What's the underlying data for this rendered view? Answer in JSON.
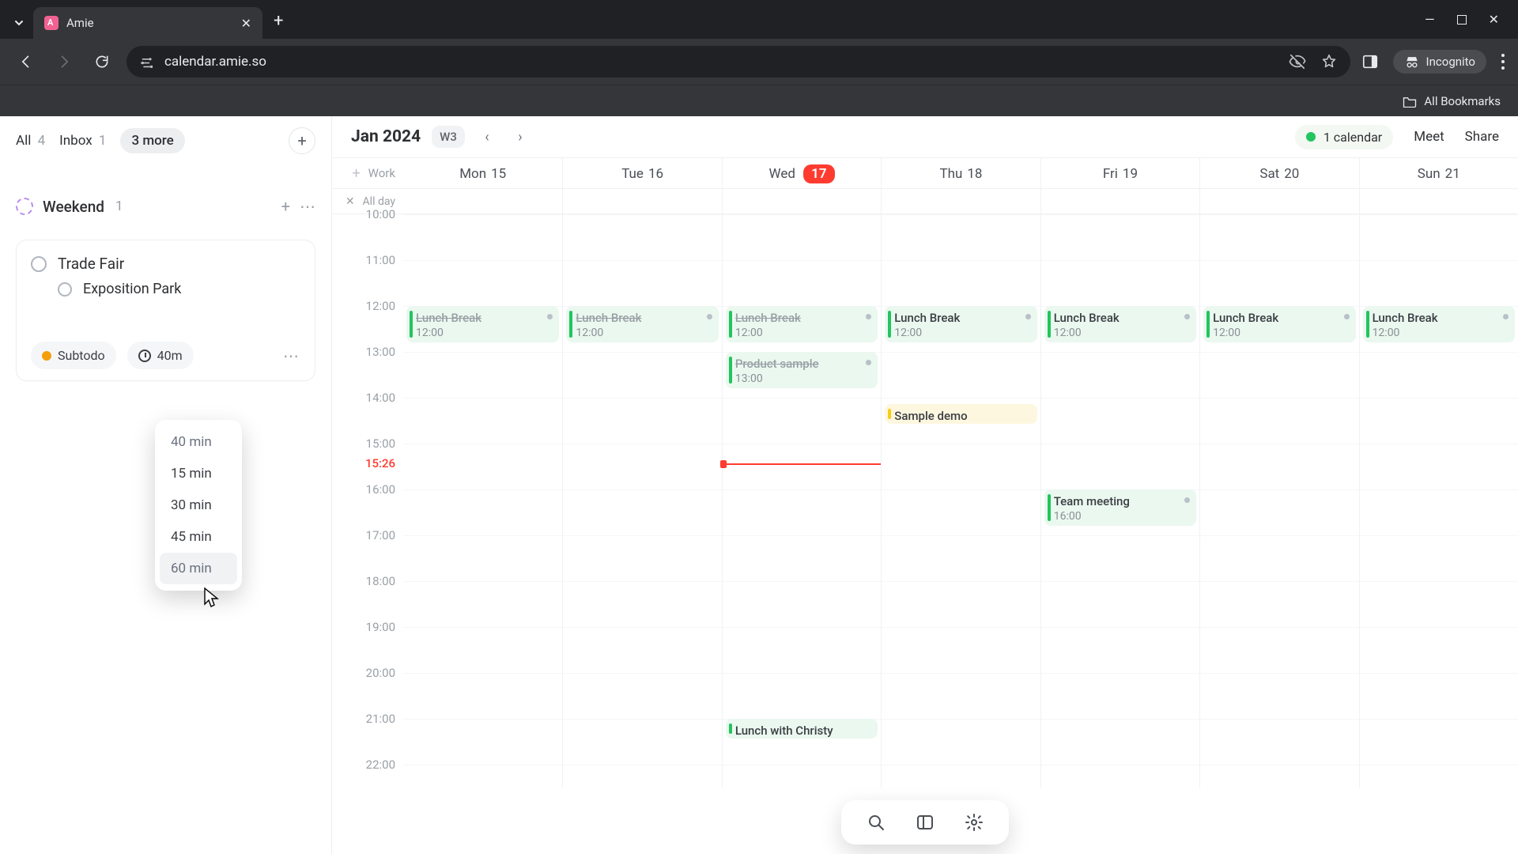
{
  "browser": {
    "tab_title": "Amie",
    "url": "calendar.amie.so",
    "incognito_label": "Incognito",
    "all_bookmarks": "All Bookmarks"
  },
  "sidebar": {
    "tabs": {
      "all_label": "All",
      "all_count": "4",
      "inbox_label": "Inbox",
      "inbox_count": "1",
      "more_label": "3 more"
    },
    "section": {
      "name": "Weekend",
      "count": "1"
    },
    "card": {
      "todo_main": "Trade Fair",
      "todo_sub": "Exposition Park",
      "subtodo_label": "Subtodo",
      "duration_label": "40m"
    },
    "dropdown": {
      "o0": "40 min",
      "o1": "15 min",
      "o2": "30 min",
      "o3": "45 min",
      "o4": "60 min"
    }
  },
  "calendar": {
    "title": "Jan 2024",
    "week_label": "W3",
    "calendars_chip": "1 calendar",
    "meet_label": "Meet",
    "share_label": "Share",
    "work_label": "Work",
    "allday_label": "All day",
    "current_time_label": "15:26",
    "days": {
      "d0": {
        "name": "Mon",
        "num": "15"
      },
      "d1": {
        "name": "Tue",
        "num": "16"
      },
      "d2": {
        "name": "Wed",
        "num": "17"
      },
      "d3": {
        "name": "Thu",
        "num": "18"
      },
      "d4": {
        "name": "Fri",
        "num": "19"
      },
      "d5": {
        "name": "Sat",
        "num": "20"
      },
      "d6": {
        "name": "Sun",
        "num": "21"
      }
    },
    "hours": {
      "h10": "10:00",
      "h11": "11:00",
      "h12": "12:00",
      "h13": "13:00",
      "h14": "14:00",
      "h15": "15:00",
      "h16": "16:00",
      "h17": "17:00",
      "h18": "18:00",
      "h19": "19:00",
      "h20": "20:00",
      "h21": "21:00",
      "h22": "22:00"
    },
    "events": {
      "lunch_title": "Lunch Break",
      "lunch_time": "12:00",
      "product_title": "Product sample",
      "product_time": "13:00",
      "sample_demo": "Sample demo",
      "team_title": "Team meeting",
      "team_time": "16:00",
      "lunch_christy": "Lunch with Christy"
    }
  }
}
